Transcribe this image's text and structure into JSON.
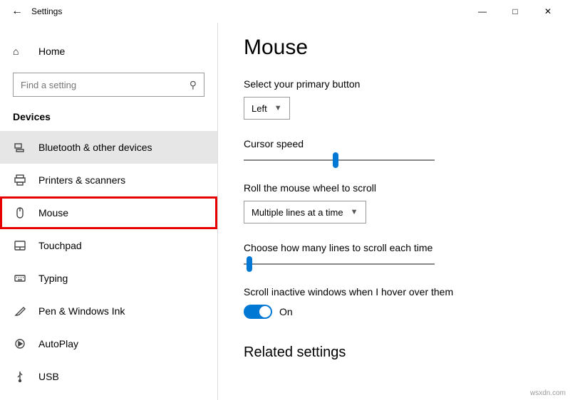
{
  "window": {
    "title": "Settings"
  },
  "home": {
    "label": "Home"
  },
  "search": {
    "placeholder": "Find a setting"
  },
  "section": "Devices",
  "nav": {
    "items": [
      {
        "label": "Bluetooth & other devices"
      },
      {
        "label": "Printers & scanners"
      },
      {
        "label": "Mouse"
      },
      {
        "label": "Touchpad"
      },
      {
        "label": "Typing"
      },
      {
        "label": "Pen & Windows Ink"
      },
      {
        "label": "AutoPlay"
      },
      {
        "label": "USB"
      }
    ]
  },
  "page": {
    "heading": "Mouse",
    "primary_button_label": "Select your primary button",
    "primary_button_value": "Left",
    "cursor_speed_label": "Cursor speed",
    "cursor_speed_pct": 48,
    "scroll_wheel_label": "Roll the mouse wheel to scroll",
    "scroll_wheel_value": "Multiple lines at a time",
    "lines_label": "Choose how many lines to scroll each time",
    "lines_pct": 3,
    "inactive_label": "Scroll inactive windows when I hover over them",
    "inactive_state": "On",
    "related_heading": "Related settings"
  },
  "watermark": "wsxdn.com"
}
